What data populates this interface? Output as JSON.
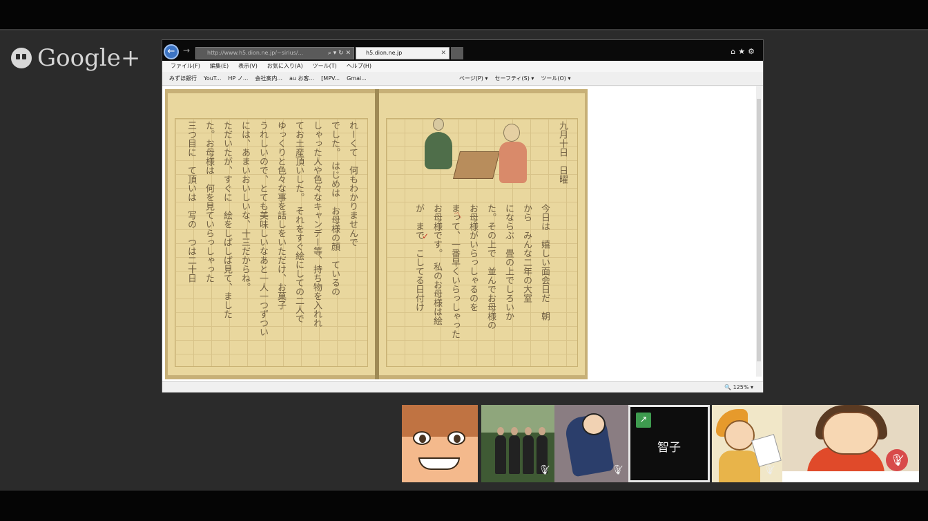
{
  "google_plus": {
    "logo_text": "Google+"
  },
  "browser": {
    "address_text": "http://www.h5.dion.ne.jp/~sirius/...",
    "tab_title": "h5.dion.ne.jp",
    "menu": [
      "ファイル(F)",
      "編集(E)",
      "表示(V)",
      "お気に入り(A)",
      "ツール(T)",
      "ヘルプ(H)"
    ],
    "favorites": [
      "みずほ銀行",
      "YouT...",
      "HP ノ...",
      "会社案内...",
      "au お客...",
      "[MPV...",
      "Gmai..."
    ],
    "tools": [
      "ページ(P) ▾",
      "セーフティ(S) ▾",
      "ツール(O) ▾"
    ],
    "zoom": "125%",
    "notebook": {
      "left_page_lines": [
        "れーくて　何もわかりませんで",
        "でした。　はじめは　お母様の顔　ているの",
        "しゃった人や色々なキャンデー等、持ち物を入れれ",
        "てお土産頂いした。　それをすぐ絵にしての二人で",
        "ゆっくりと色々な事を話しをいただけ、お菓子",
        "うれしいので、とても美味しいなあと一人一つずつい",
        "には、あまいおいしいな、十三だからね。",
        "ただいたが、すぐに　絵をしばしば見て、ました",
        "た。お母様は　何を見ていらっしゃった",
        "三つ目に　て頂いは　写の　つは二十日"
      ],
      "right_page_lines": [
        "九月十日　日曜",
        "今日は　嬉しい面会日だ　朝",
        "から　みんな二年の大室",
        "にならぶ　畳の上でしろいか",
        "た。その上で　並んでお母様の",
        "お母様がいらっしゃるのを",
        "まって、一番早くいらっしゃった",
        "お母様です。　私のお母様は絵",
        "が　まで　こしてる日付け"
      ]
    }
  },
  "participants": [
    {
      "kind": "avatar",
      "icon": "anime-girl-avatar",
      "muted": false
    },
    {
      "kind": "photo",
      "icon": "group-photo-avatar",
      "muted": true
    },
    {
      "kind": "avatar",
      "icon": "detective-avatar",
      "muted": true
    },
    {
      "kind": "screen-share",
      "name": "智子",
      "icon": "share-icon",
      "muted": false,
      "active": true
    },
    {
      "kind": "illustration",
      "icon": "drawing-kid-avatar",
      "muted": true
    },
    {
      "kind": "illustration",
      "icon": "girl-with-desk-avatar",
      "muted": true,
      "self": true
    }
  ],
  "colors": {
    "mute_red": "#d84a4a",
    "share_green": "#3e9b4f",
    "ie_blue": "#3c74c4"
  }
}
